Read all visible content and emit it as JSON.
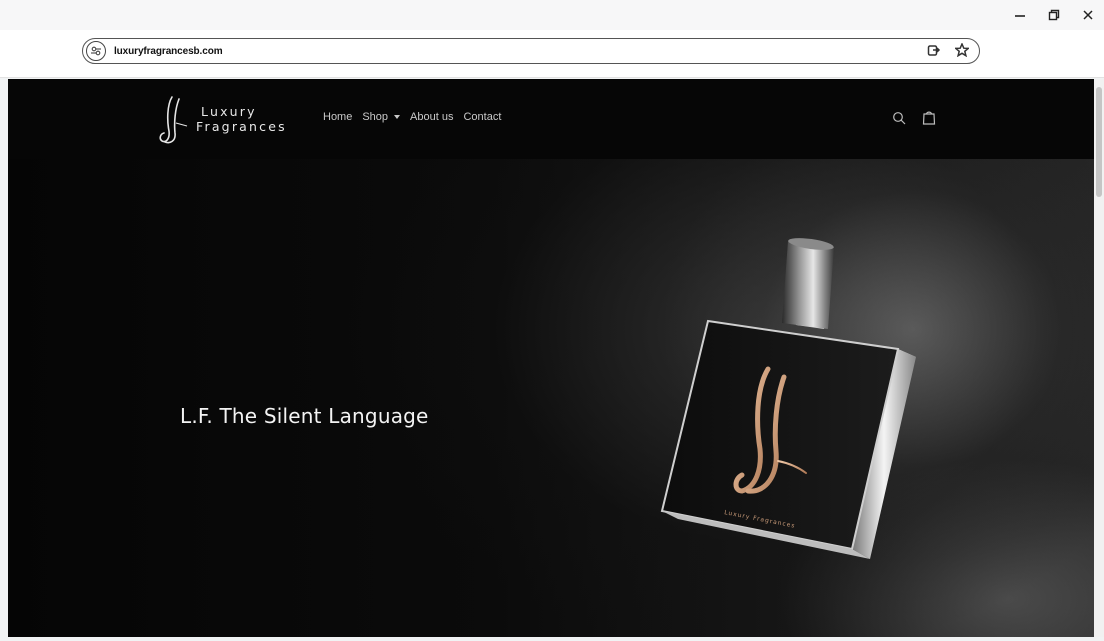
{
  "browser": {
    "url": "luxuryfragrancesb.com",
    "window_controls": [
      "minimize",
      "restore",
      "close"
    ]
  },
  "header": {
    "logo_line1": "Luxury",
    "logo_line2": "Fragrances",
    "nav": [
      {
        "label": "Home"
      },
      {
        "label": "Shop",
        "has_dropdown": true
      },
      {
        "label": "About us"
      },
      {
        "label": "Contact"
      }
    ],
    "icons": [
      "search-icon",
      "cart-icon"
    ]
  },
  "hero": {
    "title": "L.F. The Silent Language",
    "image": "perfume-bottle"
  },
  "colors": {
    "header_bg": "#060606",
    "hero_text": "#f3f3f3",
    "nav_text": "#c9c9c9",
    "accent_gold": "#c89a78"
  }
}
